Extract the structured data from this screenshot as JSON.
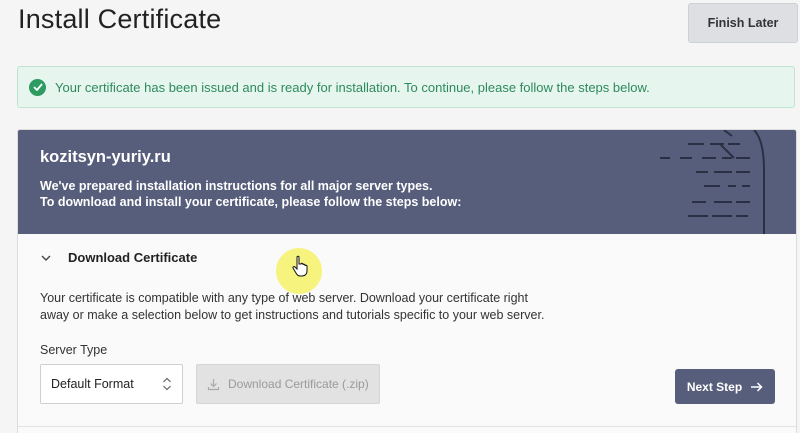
{
  "header": {
    "title": "Install Certificate",
    "finish_later_label": "Finish Later"
  },
  "banner": {
    "message": "Your certificate has been issued and is ready for installation. To continue, please follow the steps below.",
    "icon": "check-circle-icon",
    "color": "#2e9b63"
  },
  "card": {
    "domain": "kozitsyn-yuriy.ru",
    "line1": "We've prepared installation instructions for all major server types.",
    "line2": "To download and install your certificate, please follow the steps below:",
    "header_color": "#575e7b"
  },
  "section": {
    "title": "Download Certificate",
    "description_line1": "Your certificate is compatible with any type of web server. Download your certificate right",
    "description_line2": "away or make a selection below to get instructions and tutorials specific to your web server.",
    "server_type_label": "Server Type",
    "server_type_value": "Default Format",
    "download_label": "Download Certificate (.zip)",
    "next_label": "Next Step"
  }
}
